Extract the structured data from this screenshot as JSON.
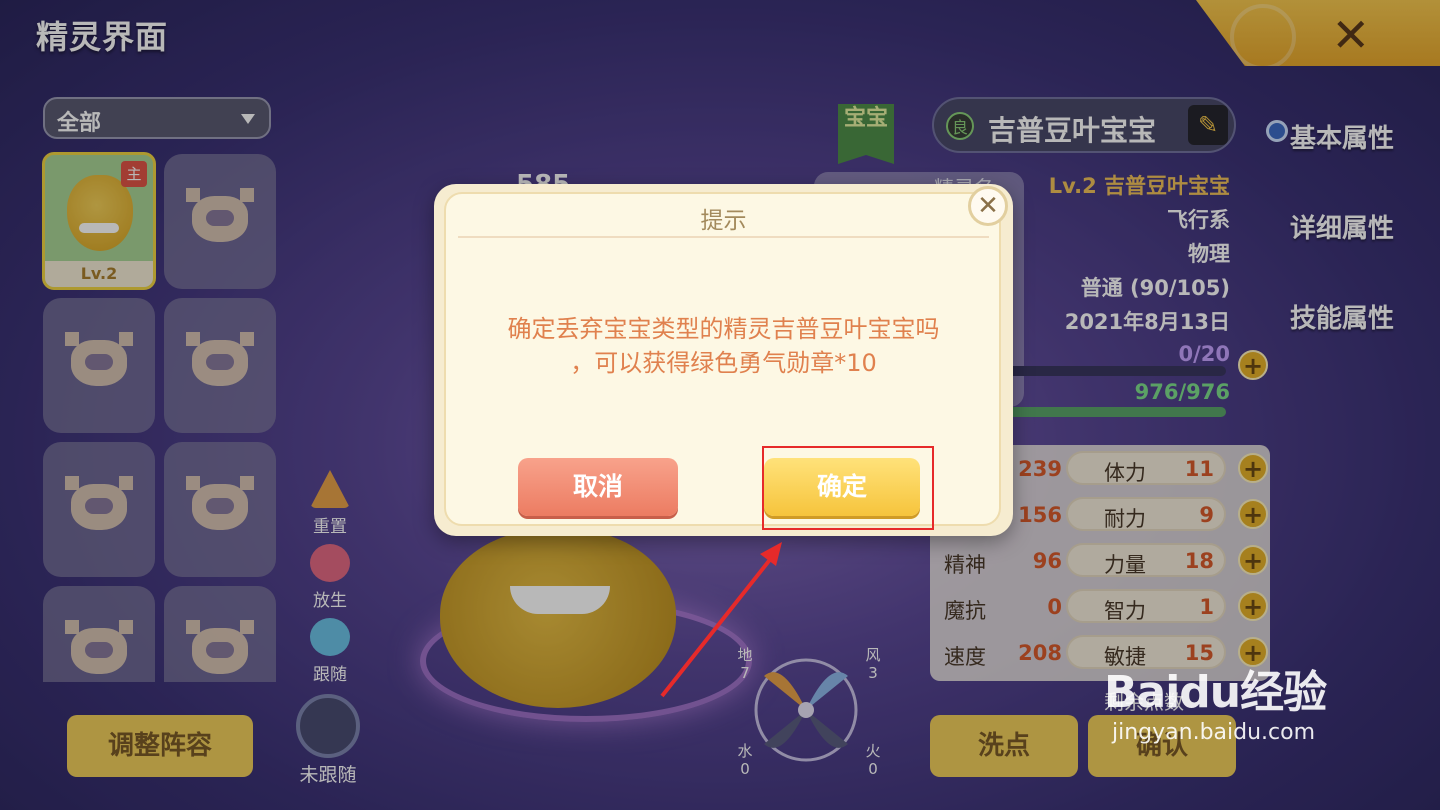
{
  "header": {
    "title": "精灵界面",
    "close_label": "✕"
  },
  "filter": {
    "selected": "全部"
  },
  "pet_list": {
    "main_level": "Lv.2",
    "main_tag": "主"
  },
  "actions": {
    "reset": "重置",
    "release": "放生",
    "follow": "跟随",
    "unfollow": "未跟随"
  },
  "bottom": {
    "adjust_team": "调整阵容",
    "wash_points": "洗点",
    "confirm": "确认"
  },
  "pet": {
    "badge": "宝宝",
    "quality": "良",
    "name": "吉普豆叶宝宝",
    "partial_number": "585",
    "label_name_partial": "精灵名",
    "level_name": "Lv.2 吉普豆叶宝宝",
    "element": "飞行系",
    "attack_type": "物理",
    "growth": "普通 (90/105)",
    "date": "2021年8月13日",
    "exp": "0/20",
    "hp": "976/976"
  },
  "elements": {
    "earth_label": "地",
    "earth": "7",
    "wind_label": "风",
    "wind": "3",
    "water_label": "水",
    "water": "0",
    "fire_label": "火",
    "fire": "0"
  },
  "tabs": [
    "基本属性",
    "详细属性",
    "技能属性"
  ],
  "stats_left": [
    {
      "label": "",
      "value": "239"
    },
    {
      "label": "",
      "value": "156"
    },
    {
      "label": "精神",
      "value": "96"
    },
    {
      "label": "魔抗",
      "value": "0"
    },
    {
      "label": "速度",
      "value": "208"
    }
  ],
  "stats_right": [
    {
      "label": "体力",
      "value": "11"
    },
    {
      "label": "耐力",
      "value": "9"
    },
    {
      "label": "力量",
      "value": "18"
    },
    {
      "label": "智力",
      "value": "1"
    },
    {
      "label": "敏捷",
      "value": "15"
    }
  ],
  "remaining_points_label": "剩余点数",
  "dialog": {
    "title": "提示",
    "message_line1": "确定丢弃宝宝类型的精灵吉普豆叶宝宝吗",
    "message_line2": "，可以获得绿色勇气勋章*10",
    "cancel": "取消",
    "ok": "确定",
    "close": "✕"
  },
  "watermark": {
    "brand": "Baidu经验",
    "url": "jingyan.baidu.com"
  },
  "colors": {
    "accent_gold": "#f2cf5c",
    "highlight_red": "#e62a2a",
    "cancel_red": "#ec7c62",
    "ok_yellow": "#f6c43c"
  }
}
